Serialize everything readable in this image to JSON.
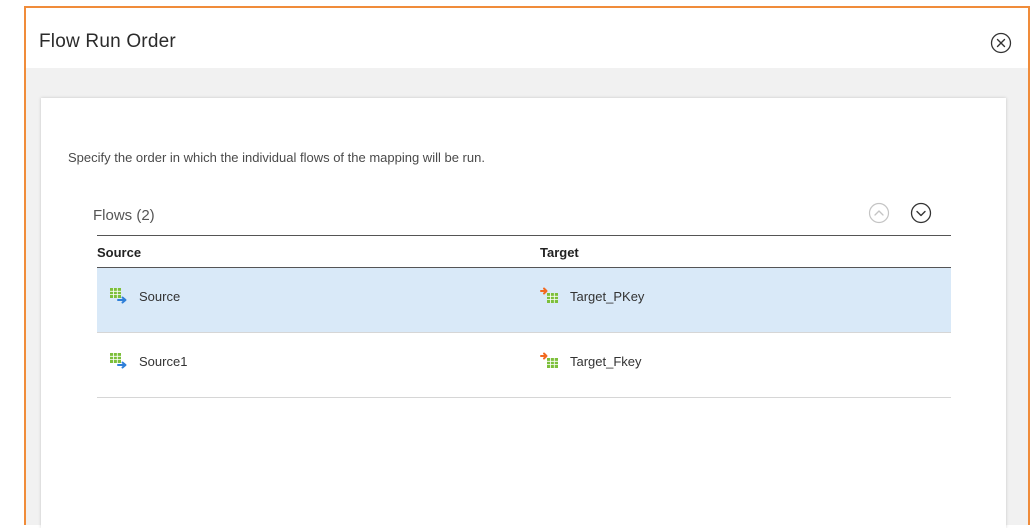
{
  "dialog": {
    "title": "Flow Run Order",
    "close_icon": "close-circle-icon"
  },
  "panel": {
    "description": "Specify the order in which the individual flows of the mapping will be run.",
    "flows_label": "Flows (2)",
    "move_up_icon": "chevron-up-circle-icon",
    "move_down_icon": "chevron-down-circle-icon"
  },
  "table": {
    "headers": {
      "source": "Source",
      "target": "Target"
    },
    "rows": [
      {
        "source": "Source",
        "target": "Target_PKey",
        "selected": true
      },
      {
        "source": "Source1",
        "target": "Target_Fkey",
        "selected": false
      }
    ]
  },
  "colors": {
    "accent_border": "#f08c3a",
    "selected_row": "#d9e9f8",
    "source_icon_green": "#7cbf3a",
    "source_icon_blue": "#2f7fd8",
    "target_icon_orange": "#f26a21"
  }
}
